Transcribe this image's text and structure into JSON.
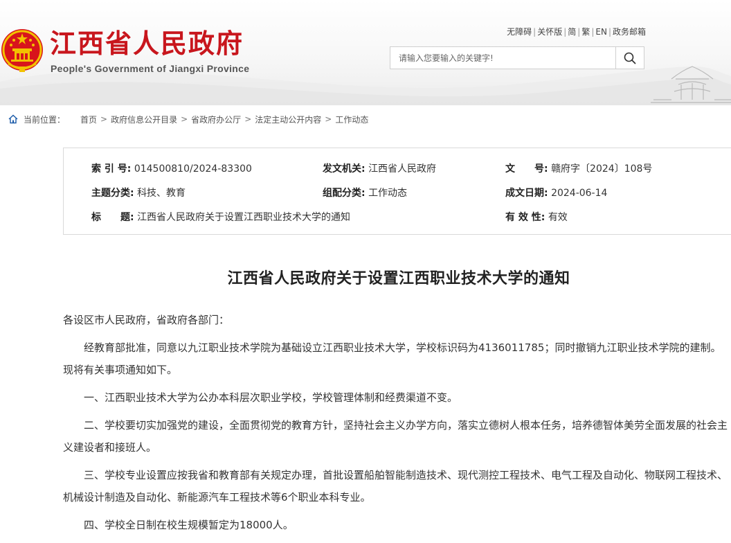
{
  "header": {
    "site_title": "江西省人民政府",
    "site_subtitle": "People's Government of Jiangxi Province",
    "links": [
      "无障碍",
      "关怀版",
      "简",
      "繁",
      "EN",
      "政务邮箱"
    ],
    "search_placeholder": "请输入您要输入的关键字!",
    "colors": {
      "brand_red": "#c8161d"
    }
  },
  "breadcrumb": {
    "label": "当前位置：",
    "items": [
      "首页",
      "政府信息公开目录",
      "省政府办公厅",
      "法定主动公开内容",
      "工作动态"
    ]
  },
  "meta": {
    "index_no": {
      "label": "索 引 号:",
      "value": "014500810/2024-83300"
    },
    "issuer": {
      "label": "发文机关:",
      "value": "江西省人民政府"
    },
    "doc_no": {
      "label": "文　　号:",
      "value": "赣府字〔2024〕108号"
    },
    "topic": {
      "label": "主题分类:",
      "value": "科技、教育"
    },
    "category": {
      "label": "组配分类:",
      "value": "工作动态"
    },
    "date": {
      "label": "成文日期:",
      "value": "2024-06-14"
    },
    "title": {
      "label": "标　　题:",
      "value": "江西省人民政府关于设置江西职业技术大学的通知"
    },
    "validity": {
      "label": "有 效 性:",
      "value": "有效"
    }
  },
  "article": {
    "title": "江西省人民政府关于设置江西职业技术大学的通知",
    "salutation": "各设区市人民政府，省政府各部门：",
    "paragraphs": [
      "经教育部批准，同意以九江职业技术学院为基础设立江西职业技术大学，学校标识码为4136011785；同时撤销九江职业技术学院的建制。现将有关事项通知如下。",
      "一、江西职业技术大学为公办本科层次职业学校，学校管理体制和经费渠道不变。",
      "二、学校要切实加强党的建设，全面贯彻党的教育方针，坚持社会主义办学方向，落实立德树人根本任务，培养德智体美劳全面发展的社会主义建设者和接班人。",
      "三、学校专业设置应按我省和教育部有关规定办理，首批设置船舶智能制造技术、现代测控工程技术、电气工程及自动化、物联网工程技术、机械设计制造及自动化、新能源汽车工程技术等6个职业本科专业。",
      "四、学校全日制在校生规模暂定为18000人。"
    ]
  }
}
